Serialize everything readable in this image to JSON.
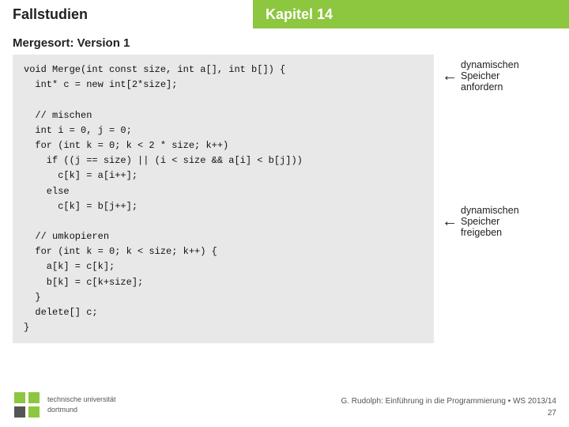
{
  "header": {
    "left_title": "Fallstudien",
    "right_title": "Kapitel 14",
    "accent_color": "#8dc63f"
  },
  "subtitle": "Mergesort: Version 1",
  "code": {
    "lines": [
      "void Merge(int const size, int a[], int b[]) {",
      "  int* c = new int[2*size];",
      "",
      "  // mischen",
      "  int i = 0, j = 0;",
      "  for (int k = 0; k < 2 * size; k++)",
      "    if ((j == size) || (i < size && a[i] < b[j]))",
      "      c[k] = a[i++];",
      "    else",
      "      c[k] = b[j++];",
      "",
      "  // umkopieren",
      "  for (int k = 0; k < size; k++) {",
      "    a[k] = c[k];",
      "    b[k] = c[k+size];",
      "  }",
      "  delete[] c;",
      "}"
    ]
  },
  "annotations": {
    "top": {
      "arrow": "←",
      "line1": "dynamischen",
      "line2": "Speicher",
      "line3": "anfordern"
    },
    "bottom": {
      "arrow": "←",
      "line1": "dynamischen",
      "line2": "Speicher",
      "line3": "freigeben"
    }
  },
  "footer": {
    "university_line1": "technische universität",
    "university_line2": "dortmund",
    "reference": "G. Rudolph: Einführung in die Programmierung • WS 2013/14",
    "page": "27"
  }
}
